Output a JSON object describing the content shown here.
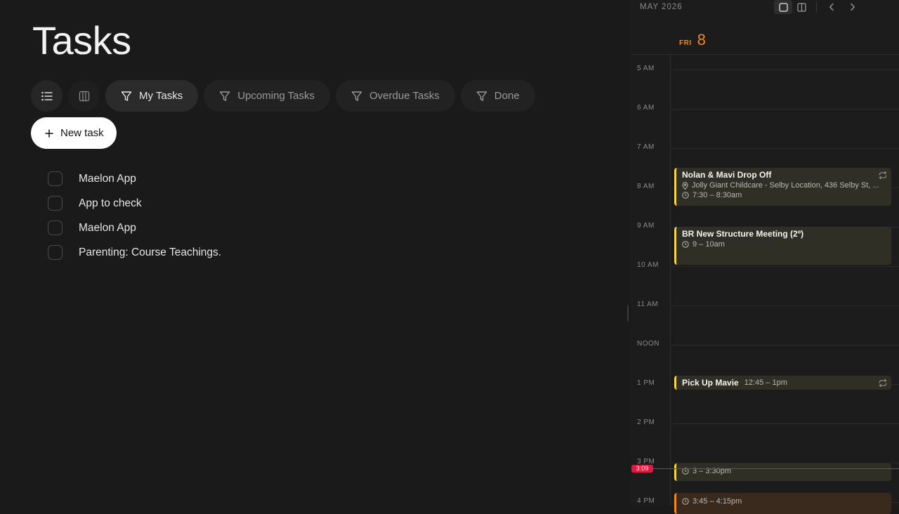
{
  "tasks": {
    "title": "Tasks",
    "view_buttons": [
      {
        "icon": "list-icon"
      },
      {
        "icon": "board-icon"
      }
    ],
    "filters": [
      {
        "label": "My Tasks",
        "icon": "filter-icon",
        "active": true
      },
      {
        "label": "Upcoming Tasks",
        "icon": "filter-icon",
        "active": false
      },
      {
        "label": "Overdue Tasks",
        "icon": "filter-icon",
        "active": false
      },
      {
        "label": "Done",
        "icon": "filter-icon",
        "active": false
      }
    ],
    "new_task_label": "New task",
    "items": [
      {
        "text": "Maelon App",
        "done": false
      },
      {
        "text": "App to check",
        "done": false
      },
      {
        "text": "Maelon App",
        "done": false
      },
      {
        "text": "Parenting: Course Teachings.",
        "done": false
      }
    ]
  },
  "calendar": {
    "month": "MAY 2026",
    "day_name": "FRI",
    "day_number": "8",
    "accent_color": "#f08a24",
    "hours": [
      "5 AM",
      "6 AM",
      "7 AM",
      "8 AM",
      "9 AM",
      "10 AM",
      "11 AM",
      "NOON",
      "1 PM",
      "2 PM",
      "3 PM",
      "4 PM"
    ],
    "now_label": "3:09",
    "now_color": "#e5173f",
    "events": [
      {
        "title": "Nolan & Mavi Drop Off",
        "location": "Jolly Giant Childcare - Selby Location, 436 Selby St, ...",
        "time": "7:30 – 8:30am",
        "repeat": true,
        "color": "#f5d547"
      },
      {
        "title": "BR New Structure Meeting (2º)",
        "time": "9 – 10am",
        "repeat": false,
        "color": "#f5d547"
      },
      {
        "title": "Pick Up Mavie",
        "time": "12:45 – 1pm",
        "repeat": true,
        "color": "#f5d547"
      },
      {
        "title": "",
        "time": "3 – 3:30pm",
        "repeat": false,
        "color": "#f5d547"
      },
      {
        "title": "",
        "time": "3:45 – 4:15pm",
        "repeat": false,
        "color": "#f08a24"
      }
    ]
  }
}
